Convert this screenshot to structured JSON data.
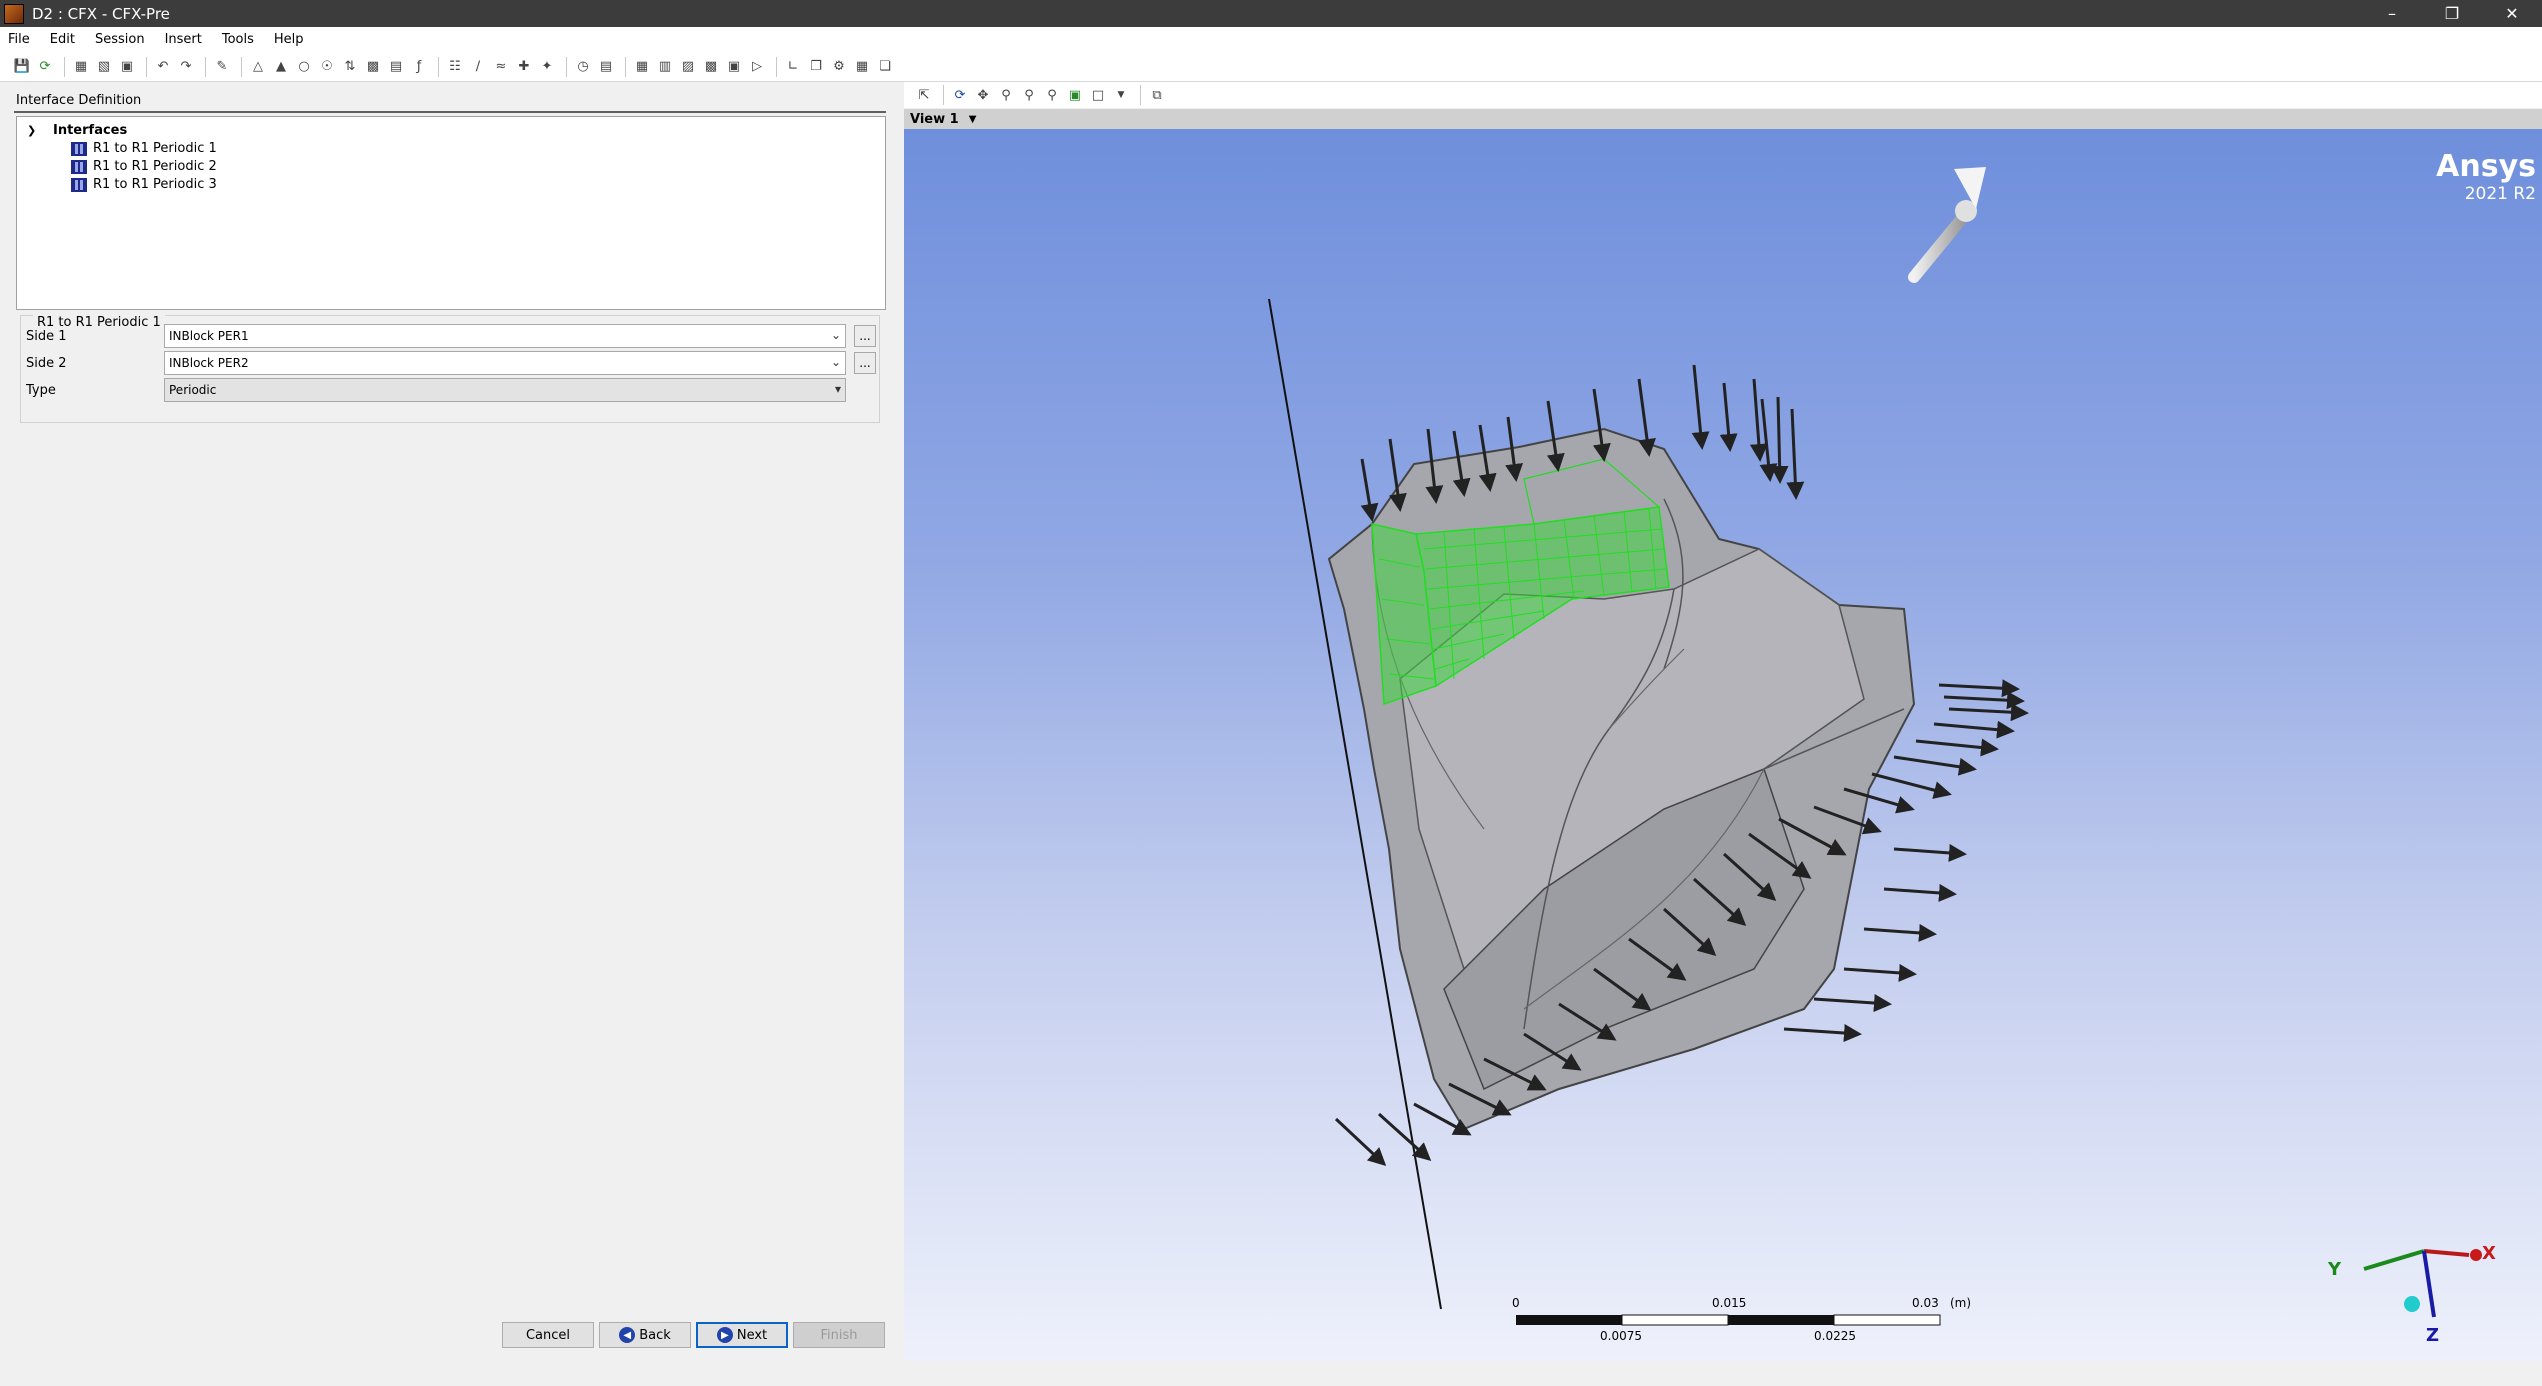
{
  "window": {
    "title": "D2 : CFX - CFX-Pre"
  },
  "menu": [
    "File",
    "Edit",
    "Session",
    "Insert",
    "Tools",
    "Help"
  ],
  "panel": {
    "tab": "Interface Definition",
    "tree": {
      "root": "Interfaces",
      "items": [
        "R1 to R1 Periodic 1",
        "R1 to R1 Periodic 2",
        "R1 to R1 Periodic 3"
      ]
    },
    "details": {
      "title": "R1 to R1 Periodic 1",
      "side1_label": "Side 1",
      "side1_value": "INBlock PER1",
      "side2_label": "Side 2",
      "side2_value": "INBlock PER2",
      "type_label": "Type",
      "type_value": "Periodic"
    },
    "buttons": {
      "cancel": "Cancel",
      "back": "Back",
      "next": "Next",
      "finish": "Finish"
    }
  },
  "viewer": {
    "view_label": "View 1",
    "logo": {
      "brand": "Ansys",
      "release": "2021 R2"
    },
    "ruler": {
      "top_ticks": [
        "0",
        "0.015",
        "0.03"
      ],
      "unit": "(m)",
      "bottom_ticks": [
        "0.0075",
        "0.0225"
      ]
    },
    "axes": {
      "x": "X",
      "y": "Y",
      "z": "Z"
    }
  },
  "colors": {
    "accent_green": "#22dd22",
    "geometry_gray": "#a8a8ae",
    "background_top": "#6f8fdc",
    "background_bottom": "#eef1fb"
  }
}
